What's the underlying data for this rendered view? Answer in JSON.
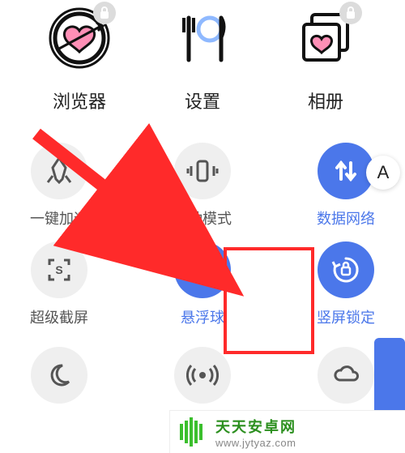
{
  "apps": [
    {
      "label": "浏览器",
      "icon": "browser-heart",
      "locked": true
    },
    {
      "label": "设置",
      "icon": "settings-utensils",
      "locked": false
    },
    {
      "label": "相册",
      "icon": "gallery-heart",
      "locked": true
    }
  ],
  "quick_settings": {
    "row1": [
      {
        "label": "一键加速",
        "icon": "rocket",
        "active": false
      },
      {
        "label": "振动模式",
        "icon": "vibrate",
        "active": false
      },
      {
        "label": "数据网络",
        "icon": "data",
        "active": true
      }
    ],
    "row2": [
      {
        "label": "超级截屏",
        "icon": "screenshot",
        "active": false
      },
      {
        "label": "悬浮球",
        "icon": "floatball",
        "active": true
      },
      {
        "label": "竖屏锁定",
        "icon": "rotation-lock",
        "active": true
      }
    ],
    "row3": [
      {
        "label": "",
        "icon": "moon",
        "active": false
      },
      {
        "label": "",
        "icon": "hotspot",
        "active": false
      },
      {
        "label": "",
        "icon": "cloud-sync",
        "active": false
      }
    ]
  },
  "side_button": {
    "label": "A"
  },
  "highlight": {
    "target": "竖屏锁定"
  },
  "watermark": {
    "title": "天天安卓网",
    "url": "www.jytyaz.com"
  },
  "colors": {
    "accent": "#4b77ea",
    "highlight": "#ff2a2a",
    "wm_green": "#2b8f1e"
  }
}
